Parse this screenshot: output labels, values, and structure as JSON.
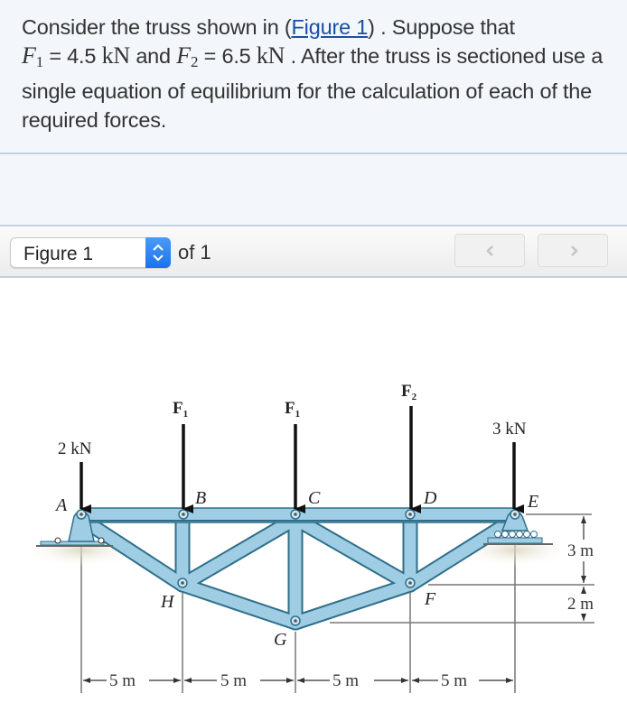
{
  "question": {
    "text_before_link": "Consider the truss shown in (",
    "link": "Figure 1",
    "text_after_link": ") . Suppose that",
    "f1_symbol": "F",
    "f1_sub": "1",
    "f1_value": " = 4.5 ",
    "f1_unit": "kN",
    "and": " and ",
    "f2_symbol": "F",
    "f2_sub": "2",
    "f2_value": " = 6.5 ",
    "f2_unit": "kN",
    "rest": " . After the truss is sectioned use a single equation of equilibrium for the calculation of each of the required forces."
  },
  "figure_nav": {
    "selected": "Figure 1",
    "of_label": "of 1",
    "prev_icon": "chevron-left-icon",
    "next_icon": "chevron-right-icon"
  },
  "truss": {
    "loads": {
      "a_load": "2 kN",
      "b_load": "F",
      "b_load_sub": "1",
      "c_load": "F",
      "c_load_sub": "1",
      "d_load": "F",
      "d_load_sub": "2",
      "e_load": "3 kN"
    },
    "joints": {
      "A": "A",
      "B": "B",
      "C": "C",
      "D": "D",
      "E": "E",
      "F": "F",
      "G": "G",
      "H": "H"
    },
    "dimensions": {
      "span1": "5 m",
      "span2": "5 m",
      "span3": "5 m",
      "span4": "5 m",
      "height1": "3 m",
      "height2": "2 m"
    },
    "colors": {
      "member_fill": "#9fcde3",
      "member_edge": "#2f6f8a",
      "load_arrow": "#111111"
    }
  }
}
